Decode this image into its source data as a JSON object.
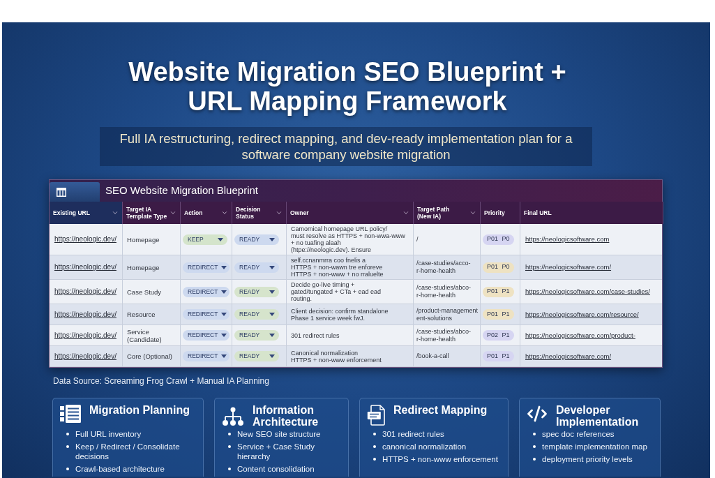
{
  "title": "Website Migration SEO Blueprint + URL Mapping Framework",
  "subtitle": "Full IA restructuring, redirect mapping, and dev-ready implementation plan for a software company website migration",
  "table": {
    "title": "SEO Website Migration Blueprint",
    "columns": [
      {
        "label": "Existing URL",
        "dropdown": true,
        "selected": true
      },
      {
        "label": "Target IA Template Type",
        "dropdown": true,
        "selected": false
      },
      {
        "label": "Action",
        "dropdown": true,
        "selected": false
      },
      {
        "label": "Decision Status",
        "dropdown": true,
        "selected": false
      },
      {
        "label": "Owner",
        "dropdown": true,
        "selected": false
      },
      {
        "label": "Target Path (New IA)",
        "dropdown": true,
        "selected": false
      },
      {
        "label": "Priority",
        "dropdown": false,
        "selected": false
      },
      {
        "label": "Final URL",
        "dropdown": false,
        "selected": false
      }
    ],
    "rows": [
      {
        "existing_url": "https://neologic.dev/",
        "template_type": "Homepage",
        "action": {
          "label": "KEEP",
          "color": "#d4e4cb"
        },
        "decision_status": {
          "label": "READY",
          "color": "#cdd9ef"
        },
        "owner": [
          "Camomical homepage URL policy/",
          "must resolve as HTTPS + non-wwa-www",
          "+ no tuafing alaah",
          "(htpe://neologic.dev). Ensure"
        ],
        "target_path": [
          "/"
        ],
        "priority": {
          "label": "P01 P0",
          "color": "#d6d5f2"
        },
        "final_url": "https://neologicsoftware.com"
      },
      {
        "existing_url": "https://neologic.dev/",
        "template_type": "Homepage",
        "action": {
          "label": "REDIRECT",
          "color": "#cdd9ef"
        },
        "decision_status": {
          "label": "READY",
          "color": "#cdd9ef"
        },
        "owner": [
          "self.ccnanmrra coo fnelis a",
          "HTTPS + non-wawn tre enforeve",
          "HTTPS + non-www + no rraluelte"
        ],
        "target_path": [
          "/case-studies/acco-",
          "r-home-health"
        ],
        "priority": {
          "label": "P01 P0",
          "color": "#eee2c2"
        },
        "final_url": "https://neologicsoftware.com/"
      },
      {
        "existing_url": "https://neologic.dev/",
        "template_type": "Case Study",
        "action": {
          "label": "REDIRECT",
          "color": "#cdd9ef"
        },
        "decision_status": {
          "label": "READY",
          "color": "#d6e4cc"
        },
        "owner": [
          "Decide go-live timing +",
          "gated/tungated + CTa + ead ead",
          "routing."
        ],
        "target_path": [
          "/case-studies/abco-",
          "r-home-health"
        ],
        "priority": {
          "label": "P01 P1",
          "color": "#eee2c2"
        },
        "final_url": "https://neologicsoftware.com/case-studies/"
      },
      {
        "existing_url": "https://neologic.dev/",
        "template_type": "Resource",
        "action": {
          "label": "REDIRECT",
          "color": "#cdd9ef"
        },
        "decision_status": {
          "label": "READY",
          "color": "#d6e4cc"
        },
        "owner": [
          "Client decision: confirm standalone",
          "Phase 1 service week fwJ."
        ],
        "target_path": [
          "/product-management",
          "ent-solutions"
        ],
        "priority": {
          "label": "P01 P1",
          "color": "#eee2c2"
        },
        "final_url": "https://neologicsoftware.com/resource/"
      },
      {
        "existing_url": "https://neologic.dev/",
        "template_type": "Service (Candidate)",
        "action": {
          "label": "REDIRECT",
          "color": "#cdd9ef"
        },
        "decision_status": {
          "label": "READY",
          "color": "#d6e4cc"
        },
        "owner": [
          "301 redirect rules"
        ],
        "target_path": [
          "/case-studies/abco-",
          "r-home-health"
        ],
        "priority": {
          "label": "P02 P1",
          "color": "#d6d5f2"
        },
        "final_url": "https://neologicsoftware.com/product-"
      },
      {
        "existing_url": "https://neologic.dev/",
        "template_type": "Core (Optional)",
        "action": {
          "label": "REDIRECT",
          "color": "#cdd9ef"
        },
        "decision_status": {
          "label": "READY",
          "color": "#d6e4cc"
        },
        "owner": [
          "Canonical normalization",
          "HTTPS + non-www enforcement"
        ],
        "target_path": [
          "/book-a-call"
        ],
        "priority": {
          "label": "P01 P1",
          "color": "#d6d5f2"
        },
        "final_url": "https://neologicsoftware.com/"
      }
    ]
  },
  "data_source": "Data Source: Screaming Frog Crawl + Manual IA Planning",
  "cards": [
    {
      "title": "Migration Planning",
      "items": [
        "Full URL inventory",
        "Keep / Redirect / Consolidate decisions",
        "Crawl-based architecture"
      ]
    },
    {
      "title": "Information Architecture",
      "items": [
        "New SEO site structure",
        "Service + Case Study hierarchy",
        "Content consolidation"
      ]
    },
    {
      "title": "Redirect Mapping",
      "items": [
        "301 redirect rules",
        "canonical normalization",
        "HTTPS + non-www enforcement"
      ]
    },
    {
      "title": "Developer Implementation",
      "items": [
        "spec doc references",
        "template implementation map",
        "deployment priority levels"
      ]
    }
  ]
}
